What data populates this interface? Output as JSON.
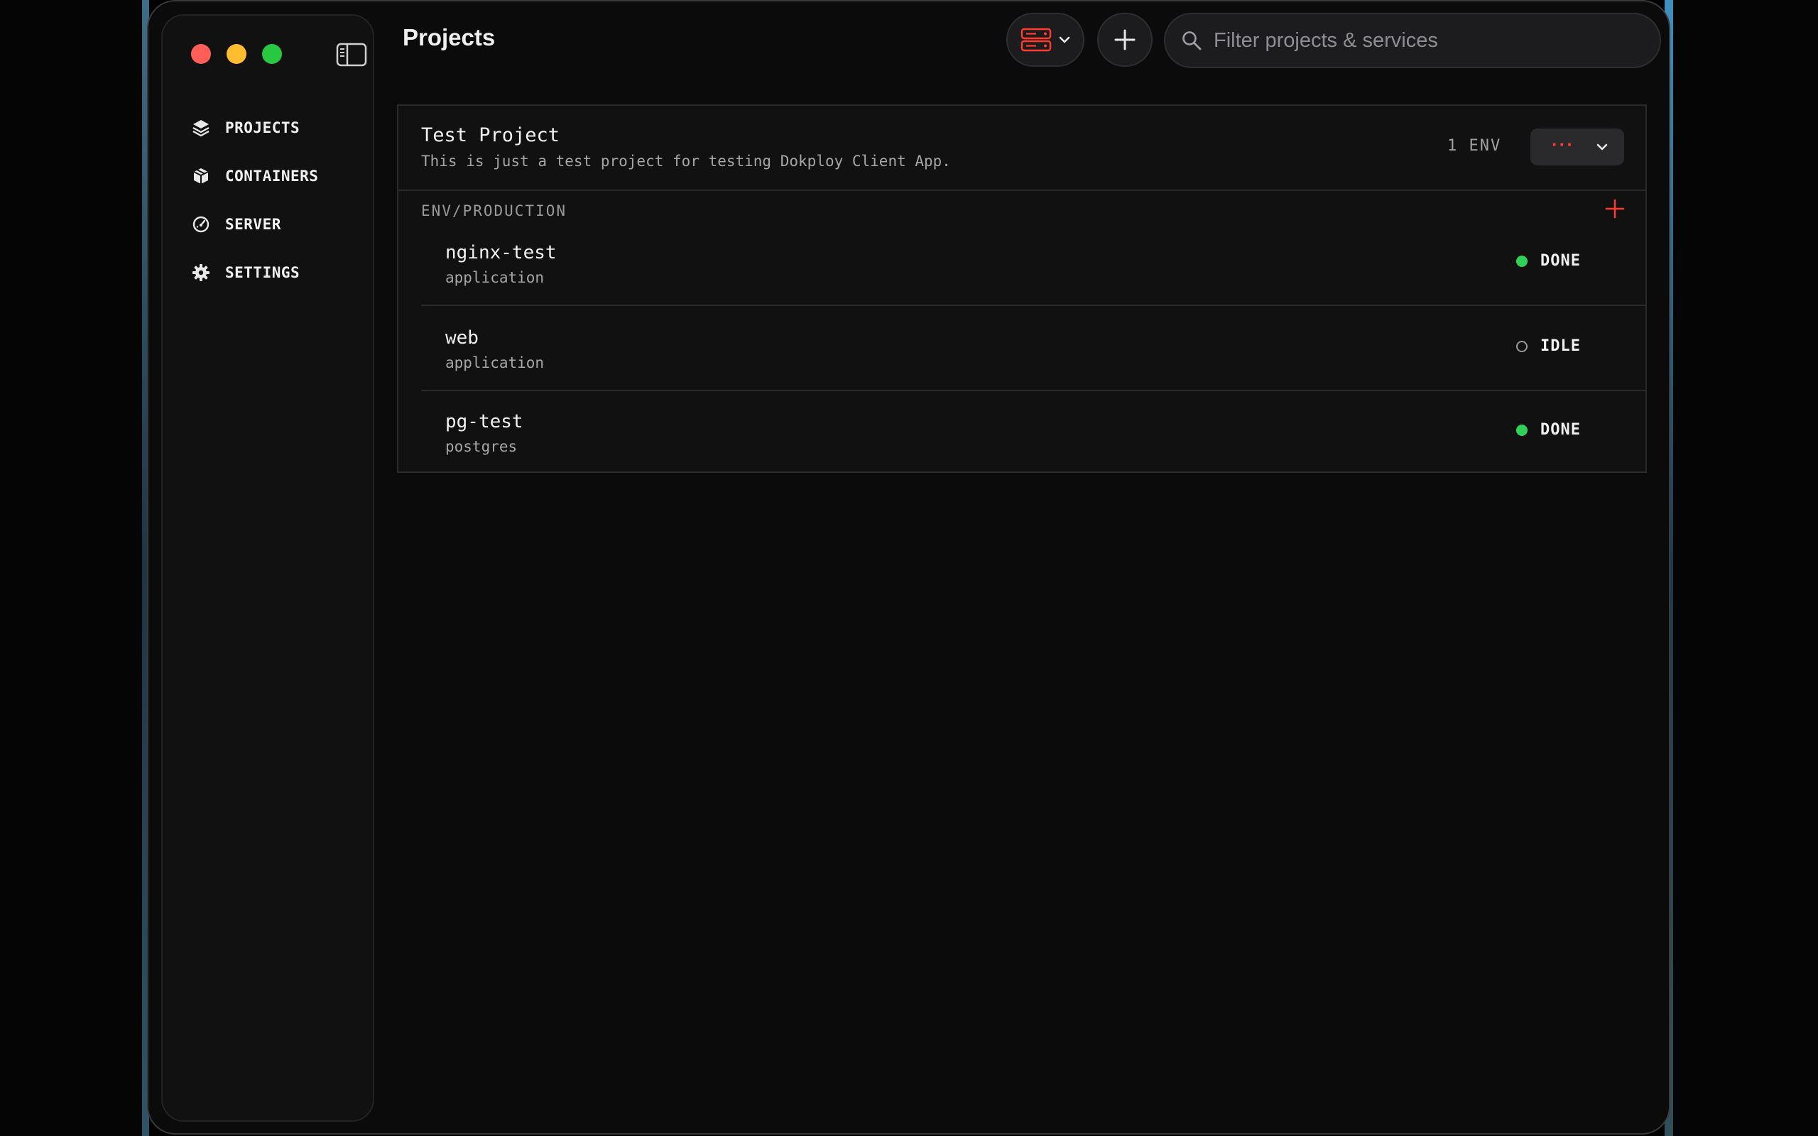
{
  "window": {
    "title": "Projects"
  },
  "sidebar": {
    "items": [
      {
        "label": "PROJECTS",
        "icon": "layers-icon"
      },
      {
        "label": "CONTAINERS",
        "icon": "box-icon"
      },
      {
        "label": "SERVER",
        "icon": "gauge-icon"
      },
      {
        "label": "SETTINGS",
        "icon": "gear-icon"
      }
    ]
  },
  "toolbar": {
    "search_placeholder": "Filter projects & services"
  },
  "colors": {
    "accent": "#ff3b30",
    "done": "#30d158",
    "idle": "#9a9a9a"
  },
  "project": {
    "name": "Test Project",
    "description": "This is just a test project for testing Dokploy Client App.",
    "env_count": "1 ENV",
    "environment": {
      "label": "ENV/PRODUCTION",
      "services": [
        {
          "name": "nginx-test",
          "type": "application",
          "status": "DONE"
        },
        {
          "name": "web",
          "type": "application",
          "status": "IDLE"
        },
        {
          "name": "pg-test",
          "type": "postgres",
          "status": "DONE"
        }
      ]
    }
  }
}
